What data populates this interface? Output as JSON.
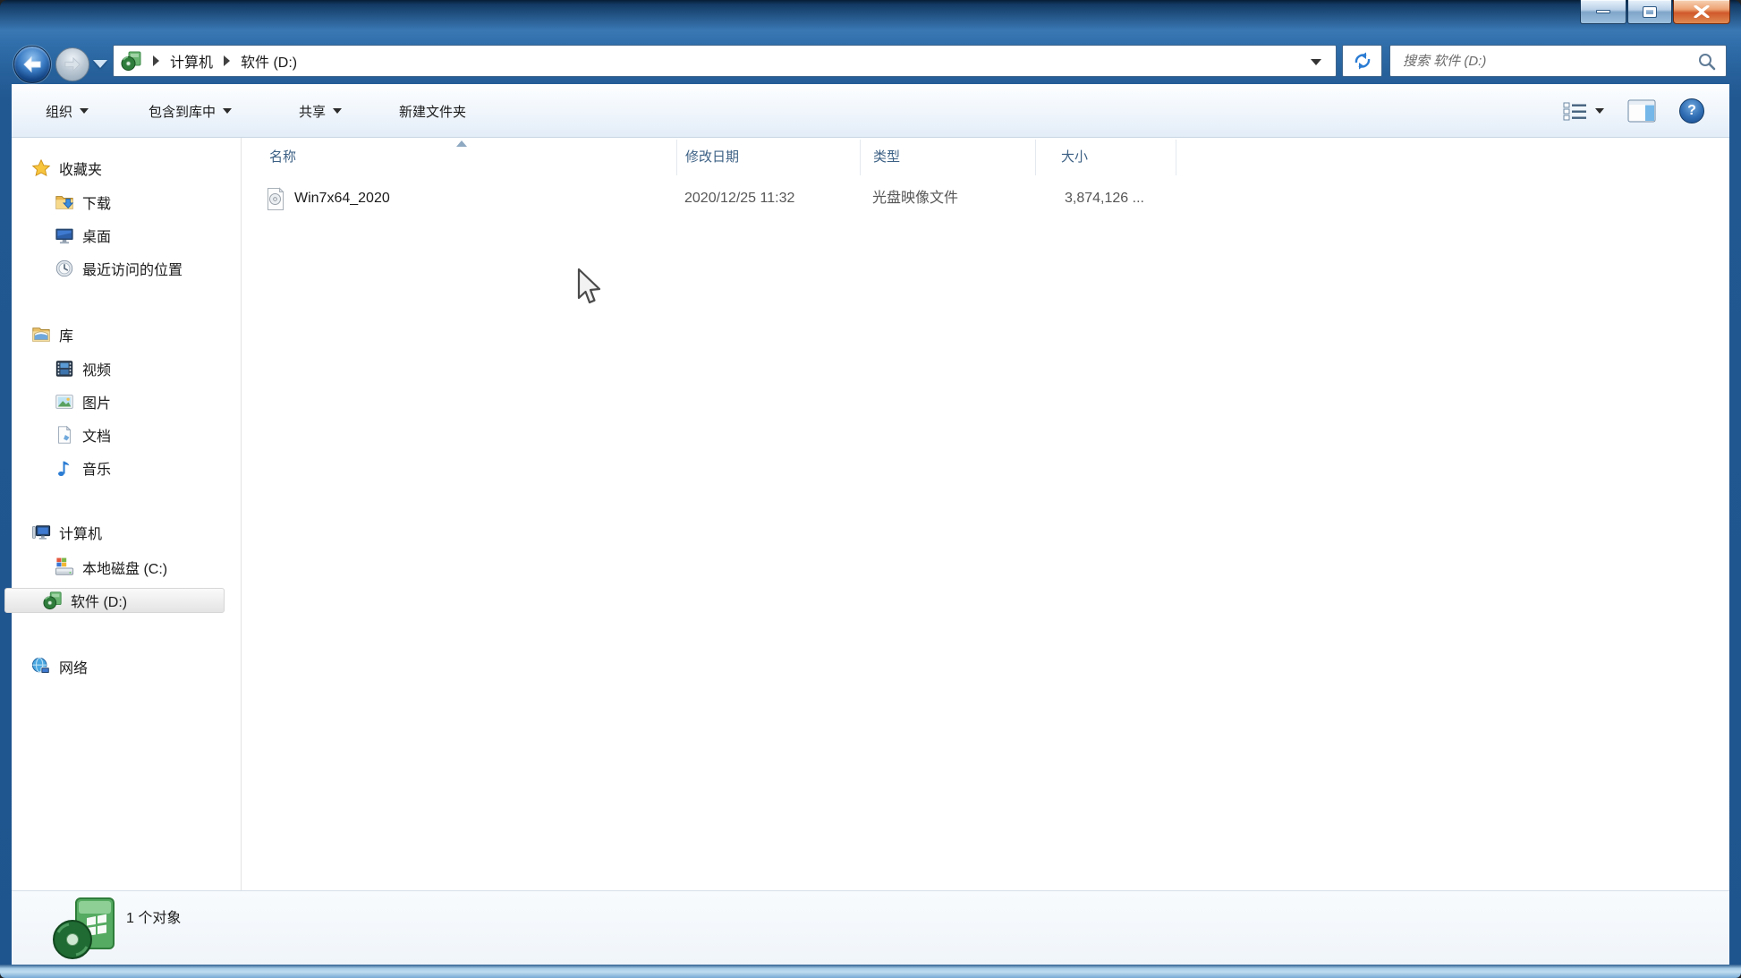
{
  "window": {
    "controls": {
      "minimize": "minimize",
      "maximize": "maximize",
      "close": "close"
    }
  },
  "nav": {
    "breadcrumb": {
      "drive_icon": "disc-drive-icon",
      "items": [
        {
          "label": "计算机"
        },
        {
          "label": "软件 (D:)"
        }
      ]
    },
    "search": {
      "placeholder": "搜索 软件 (D:)"
    }
  },
  "toolbar": {
    "items": [
      {
        "label": "组织",
        "has_menu": true
      },
      {
        "label": "包含到库中",
        "has_menu": true
      },
      {
        "label": "共享",
        "has_menu": true
      },
      {
        "label": "新建文件夹",
        "has_menu": false
      }
    ]
  },
  "list": {
    "columns": [
      {
        "label": "名称",
        "sorted": "asc"
      },
      {
        "label": "修改日期"
      },
      {
        "label": "类型"
      },
      {
        "label": "大小"
      }
    ],
    "rows": [
      {
        "name": "Win7x64_2020",
        "date_modified": "2020/12/25 11:32",
        "type": "光盘映像文件",
        "size": "3,874,126 ..."
      }
    ]
  },
  "sidebar": {
    "favorites": {
      "label": "收藏夹",
      "items": [
        {
          "label": "下载"
        },
        {
          "label": "桌面"
        },
        {
          "label": "最近访问的位置"
        }
      ]
    },
    "libraries": {
      "label": "库",
      "items": [
        {
          "label": "视频"
        },
        {
          "label": "图片"
        },
        {
          "label": "文档"
        },
        {
          "label": "音乐"
        }
      ]
    },
    "computer": {
      "label": "计算机",
      "items": [
        {
          "label": "本地磁盘 (C:)",
          "selected": false
        },
        {
          "label": "软件 (D:)",
          "selected": true
        }
      ]
    },
    "network": {
      "label": "网络"
    }
  },
  "statusbar": {
    "item_count": "1 个对象"
  },
  "icons": {
    "help_glyph": "?"
  },
  "colors": {
    "frame_blue": "#2e6ba6",
    "close_button": "#d0592b",
    "selection_gray": "#e8e8e8",
    "header_text": "#3d6185"
  }
}
